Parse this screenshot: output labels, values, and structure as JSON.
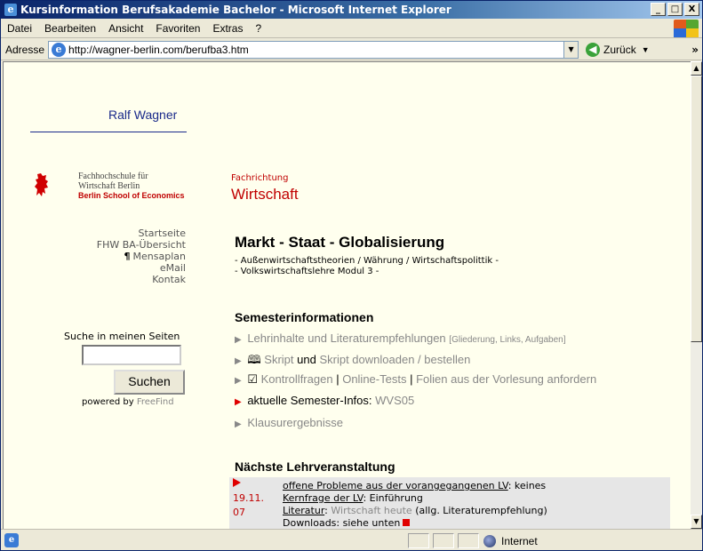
{
  "window": {
    "title": "Kursinformation Berufsakademie Bachelor - Microsoft Internet Explorer"
  },
  "window_controls": {
    "minimize": "_",
    "maximize": "□",
    "close": "X"
  },
  "menubar": {
    "items": [
      "Datei",
      "Bearbeiten",
      "Ansicht",
      "Favoriten",
      "Extras",
      "?"
    ]
  },
  "addressbar": {
    "label": "Adresse",
    "url": "http://wagner-berlin.com/berufba3.htm",
    "back_label": "Zurück",
    "more": "»"
  },
  "sidebar": {
    "owner": "Ralf Wagner",
    "school": {
      "line1": "Fachhochschule für",
      "line2": "Wirtschaft Berlin",
      "line3": "Berlin School of Economics"
    },
    "nav": [
      "Startseite",
      "FHW BA-Übersicht",
      "Mensaplan",
      "eMail",
      "Kontak"
    ],
    "search": {
      "label": "Suche in meinen Seiten",
      "value": "",
      "button": "Suchen",
      "powered_prefix": "powered by",
      "powered_brand": "FreeFind"
    }
  },
  "main": {
    "field_label": "Fachrichtung",
    "field": "Wirtschaft",
    "title": "Markt - Staat - Globalisierung",
    "sub1": "- Außenwirtschaftstheorien / Währung / Wirtschaftspolittik -",
    "sub2": "- Volkswirtschaftslehre Modul 3 -",
    "sem_title": "Semesterinformationen",
    "sem": {
      "r1_main": "Lehrinhalte und Literaturempfehlungen",
      "r1_small": "[Gliederung, Links, Aufgaben]",
      "r2_a": "Skript",
      "r2_and": "und",
      "r2_b": "Skript downloaden / bestellen",
      "r3_a": "Kontrollfragen",
      "r3_sep1": "|",
      "r3_b": "Online-Tests",
      "r3_sep2": "|",
      "r3_c": "Folien aus der Vorlesung anfordern",
      "r4_a": "aktuelle Semester-Infos:",
      "r4_b": "WVS05",
      "r5": "Klausurergebnisse"
    },
    "next_title": "Nächste Lehrveranstaltung",
    "lv": {
      "date1": "19.11.",
      "date2": "07",
      "row1_key": "offene Probleme aus der vorangegangenen LV",
      "row1_val": ": keines",
      "row2_key": "Kernfrage der LV",
      "row2_val": ": Einführung",
      "row3_key": "Literatur",
      "row3_colon": ":",
      "row3_grey": "Wirtschaft heute",
      "row3_val": "(allg. Literaturempfehlung)",
      "row4": "Downloads: siehe unten"
    }
  },
  "statusbar": {
    "zone": "Internet"
  },
  "colors": {
    "accent_red": "#c00000",
    "link_grey": "#888888",
    "page_bg": "#ffffee",
    "owner_blue": "#1a2a8a"
  }
}
